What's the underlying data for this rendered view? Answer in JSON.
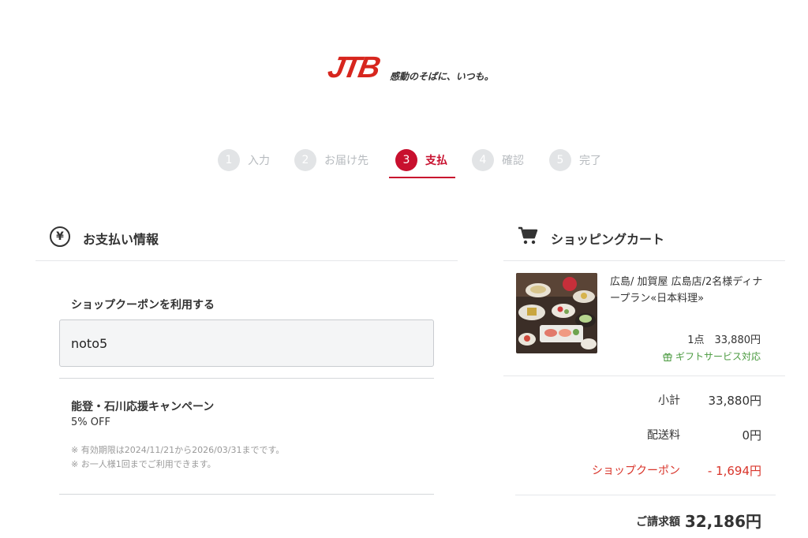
{
  "header": {
    "logo_text": "JTB",
    "tagline": "感動のそばに、いつも。"
  },
  "steps": [
    {
      "num": "1",
      "label": "入力",
      "active": false
    },
    {
      "num": "2",
      "label": "お届け先",
      "active": false
    },
    {
      "num": "3",
      "label": "支払",
      "active": true
    },
    {
      "num": "4",
      "label": "確認",
      "active": false
    },
    {
      "num": "5",
      "label": "完了",
      "active": false
    }
  ],
  "payment": {
    "title": "お支払い情報",
    "icon": "yen-icon",
    "coupon_label": "ショップクーポンを利用する",
    "coupon_value": "noto5",
    "campaign": {
      "title": "能登・石川応援キャンペーン",
      "discount": "5% OFF",
      "notes": [
        "※ 有効期限は2024/11/21から2026/03/31までです。",
        "※ お一人様1回までご利用できます。"
      ]
    }
  },
  "cart": {
    "title": "ショッピングカート",
    "icon": "cart-icon",
    "item": {
      "name": "広島/ 加賀屋 広島店/2名様ディナープラン«日本料理»",
      "qty_price": "1点　33,880円",
      "gift": "ギフトサービス対応"
    },
    "summary": [
      {
        "label": "小計",
        "value": "33,880円"
      },
      {
        "label": "配送料",
        "value": "0円"
      },
      {
        "label": "ショップクーポン",
        "value": "- 1,694円"
      }
    ],
    "total": {
      "label": "ご請求額",
      "value": "32,186円"
    }
  },
  "colors": {
    "brand_red": "#c8102e",
    "discount_red": "#d9352b",
    "gift_green": "#4a9a3f"
  }
}
